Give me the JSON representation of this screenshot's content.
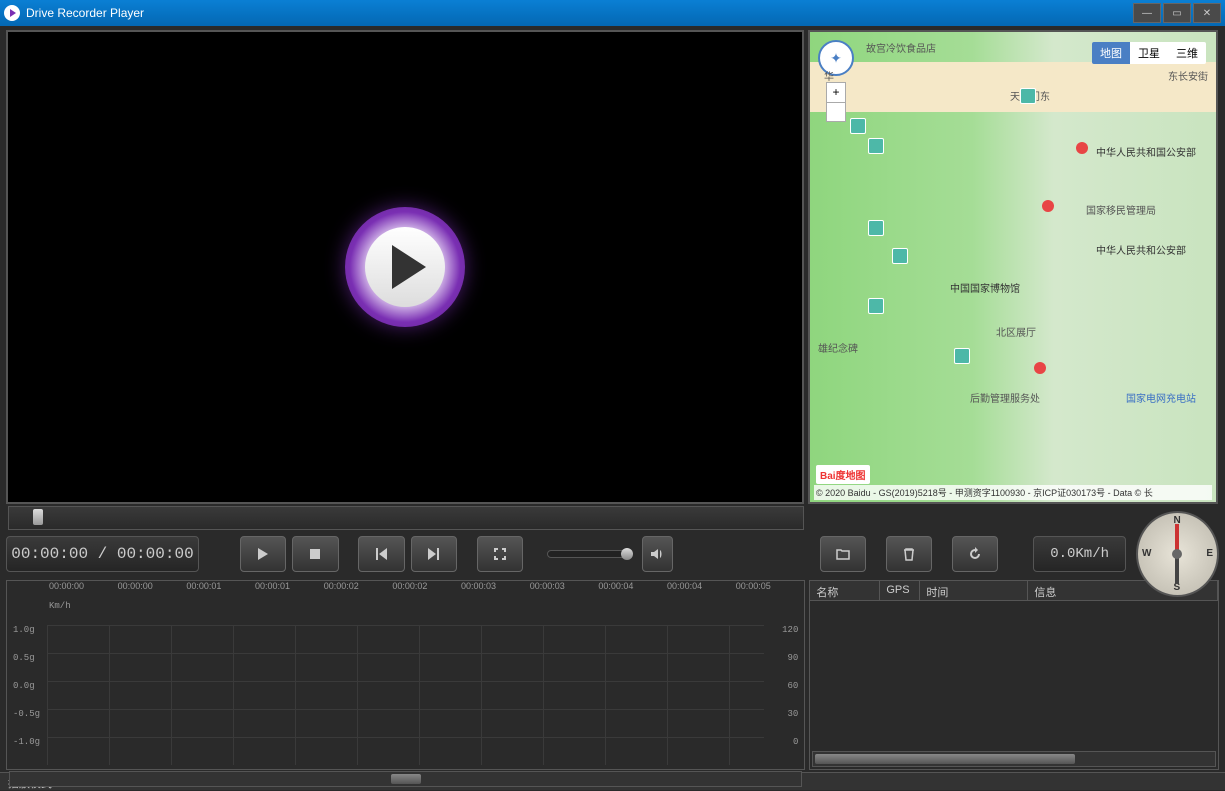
{
  "title": "Drive Recorder Player",
  "window": {
    "minimize": "—",
    "maximize": "▭",
    "close": "✕"
  },
  "time_display": "00:00:00 / 00:00:00",
  "speed_display": "0.0Km/h",
  "map": {
    "tabs": [
      "地图",
      "卫星",
      "三维"
    ],
    "active_tab": 0,
    "labels": {
      "top1": "故宫冷饮食品店",
      "top2": "东长安街",
      "center": "天安门东",
      "museum": "中国国家博物馆",
      "memorial": "雄纪念碑",
      "north_hall": "北区展厅",
      "logistics": "后勤管理服务处",
      "charge": "国家电网充电站",
      "immigration": "国家移民管理局",
      "public_sec": "中华人民共和国公安部",
      "public_sec2": "中华人民共和公安部",
      "hua": "华"
    },
    "baidu": "Bai度地图",
    "copyright": "© 2020 Baidu - GS(2019)5218号 - 甲测资字1100930 - 京ICP证030173号 - Data © 长"
  },
  "compass": {
    "n": "N",
    "e": "E",
    "s": "S",
    "w": "W"
  },
  "chart_data": {
    "type": "line",
    "x_ticks": [
      "00:00:00",
      "00:00:00",
      "00:00:01",
      "00:00:01",
      "00:00:02",
      "00:00:02",
      "00:00:03",
      "00:00:03",
      "00:00:04",
      "00:00:04",
      "00:00:05"
    ],
    "y_left": [
      "1.0g",
      "0.5g",
      "0.0g",
      "-0.5g",
      "-1.0g"
    ],
    "y_right": [
      "120",
      "90",
      "60",
      "30",
      "0"
    ],
    "right_unit": "Km/h",
    "series": []
  },
  "list": {
    "cols": {
      "name": "名称",
      "gps": "GPS",
      "time": "时间",
      "info": "信息"
    }
  },
  "status": "播放模式"
}
